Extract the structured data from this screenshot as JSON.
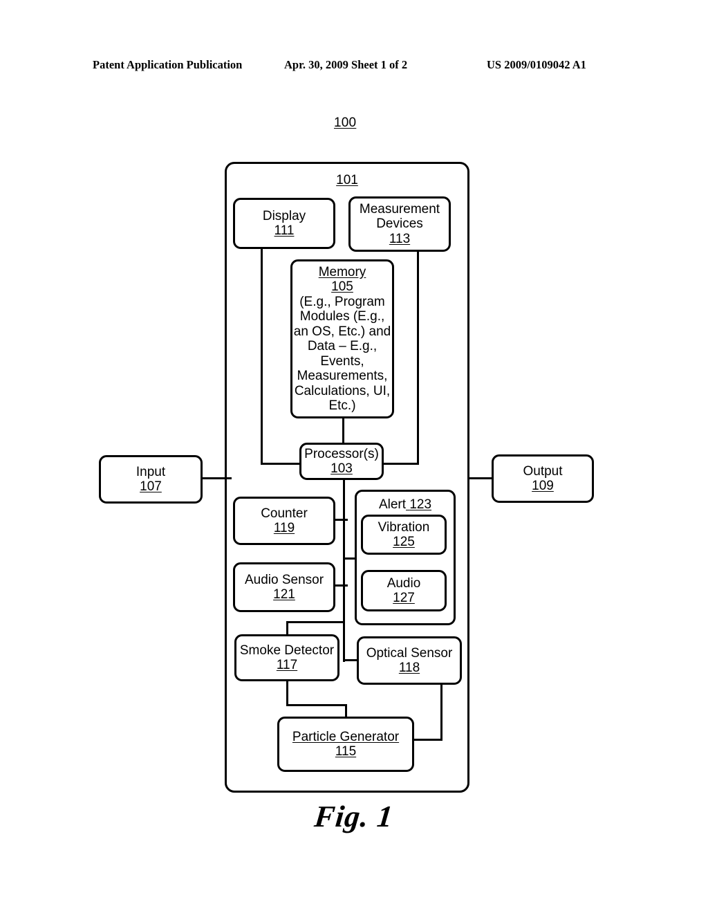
{
  "header": {
    "publication": "Patent Application Publication",
    "date_sheet": "Apr. 30, 2009  Sheet 1 of 2",
    "patent_number": "US 2009/0109042 A1"
  },
  "figure": {
    "caption": "Fig. 1",
    "system_label": "100",
    "device_label": "101",
    "blocks": {
      "display": {
        "title": "Display",
        "num": "111"
      },
      "measurement": {
        "title": "Measurement",
        "title2": "Devices",
        "num": "113"
      },
      "memory": {
        "title": "Memory",
        "num": "105",
        "lines": [
          "(E.g., Program",
          "Modules (E.g.,",
          "an OS, Etc.) and",
          "Data – E.g.,",
          "Events,",
          "Measurements,",
          "Calculations, UI,",
          "Etc.)"
        ]
      },
      "processor": {
        "title": "Processor(s)",
        "num": "103"
      },
      "input": {
        "title": "Input",
        "num": "107"
      },
      "output": {
        "title": "Output",
        "num": "109"
      },
      "counter": {
        "title": "Counter",
        "num": "119"
      },
      "audio_sensor": {
        "title": "Audio Sensor",
        "num": "121"
      },
      "alert": {
        "title": "Alert",
        "num": "123"
      },
      "vibration": {
        "title": "Vibration",
        "num": "125"
      },
      "audio": {
        "title": "Audio",
        "num": "127"
      },
      "smoke": {
        "title": "Smoke Detector",
        "num": "117"
      },
      "optical": {
        "title": "Optical Sensor",
        "num": "118"
      },
      "particle": {
        "title": "Particle Generator",
        "num": "115"
      }
    }
  }
}
